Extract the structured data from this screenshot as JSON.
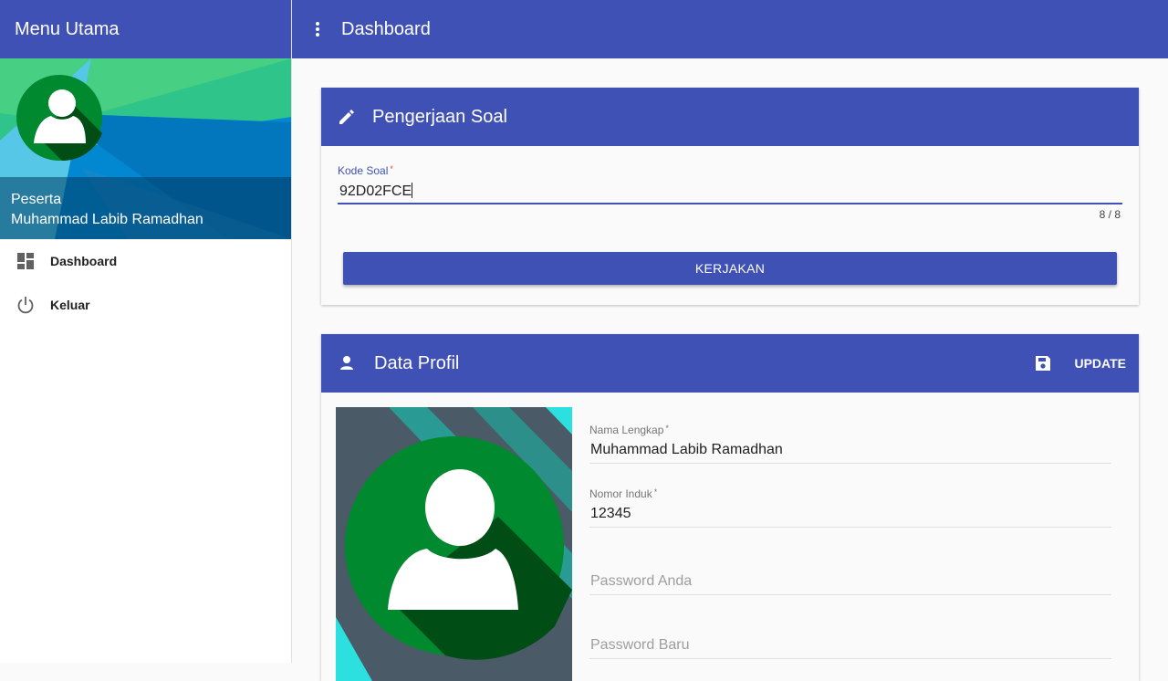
{
  "sidebar": {
    "title": "Menu Utama",
    "role": "Peserta",
    "user_name": "Muhammad Labib Ramadhan",
    "avatar_icon": "user-avatar-icon",
    "items": [
      {
        "label": "Dashboard",
        "icon": "dashboard-icon"
      },
      {
        "label": "Keluar",
        "icon": "power-icon"
      }
    ]
  },
  "topbar": {
    "title": "Dashboard",
    "menu_icon": "more-vert-icon"
  },
  "soal_card": {
    "title": "Pengerjaan Soal",
    "icon": "pencil-icon",
    "kode_label": "Kode Soal",
    "required_mark": "*",
    "kode_value": "92D02FCE",
    "counter": "8 / 8",
    "button_label": "KERJAKAN"
  },
  "profil_card": {
    "title": "Data Profil",
    "icon": "person-icon",
    "update_label": "UPDATE",
    "update_icon": "save-icon",
    "nama_label": "Nama Lengkap",
    "nama_value": "Muhammad Labib Ramadhan",
    "nomor_label": "Nomor Induk",
    "nomor_value": "12345",
    "required_mark": "*",
    "password_placeholder": "Password Anda",
    "new_password_placeholder": "Password Baru"
  },
  "colors": {
    "primary": "#3f51b5",
    "avatar_green": "#00892f",
    "avatar_shadow": "#004d15",
    "required": "#f44336"
  }
}
